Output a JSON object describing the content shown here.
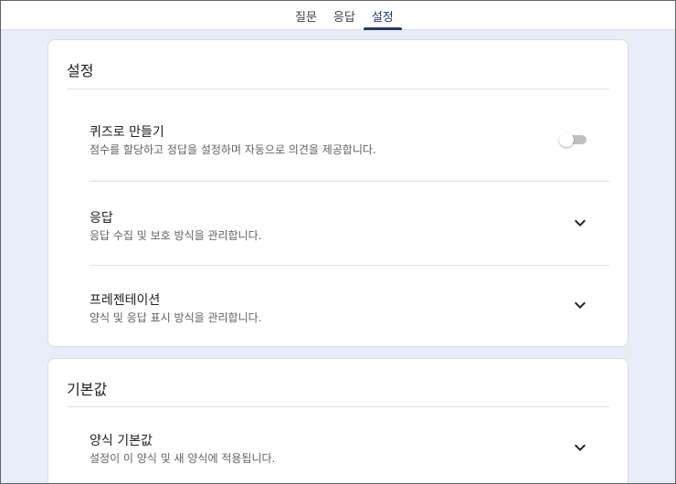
{
  "tabs": [
    {
      "label": "질문"
    },
    {
      "label": "응답"
    },
    {
      "label": "설정"
    }
  ],
  "active_tab": "설정",
  "settings_card": {
    "title": "설정",
    "rows": [
      {
        "title": "퀴즈로 만들기",
        "description": "점수를 할당하고 정답을 설정하며 자동으로 의견을 제공합니다.",
        "control": "toggle",
        "toggle_on": false
      },
      {
        "title": "응답",
        "description": "응답 수집 및 보호 방식을 관리합니다.",
        "control": "chevron-down-icon"
      },
      {
        "title": "프레젠테이션",
        "description": "양식 및 응답 표시 방식을 관리합니다.",
        "control": "chevron-down-icon"
      }
    ]
  },
  "defaults_card": {
    "title": "기본값",
    "rows": [
      {
        "title": "양식 기본값",
        "description": "설정이 이 양식 및 새 양식에 적용됩니다.",
        "control": "chevron-down-icon"
      }
    ]
  },
  "colors": {
    "page_background": "#e8edf9",
    "accent": "#1f3a6b",
    "card_background": "#ffffff"
  }
}
